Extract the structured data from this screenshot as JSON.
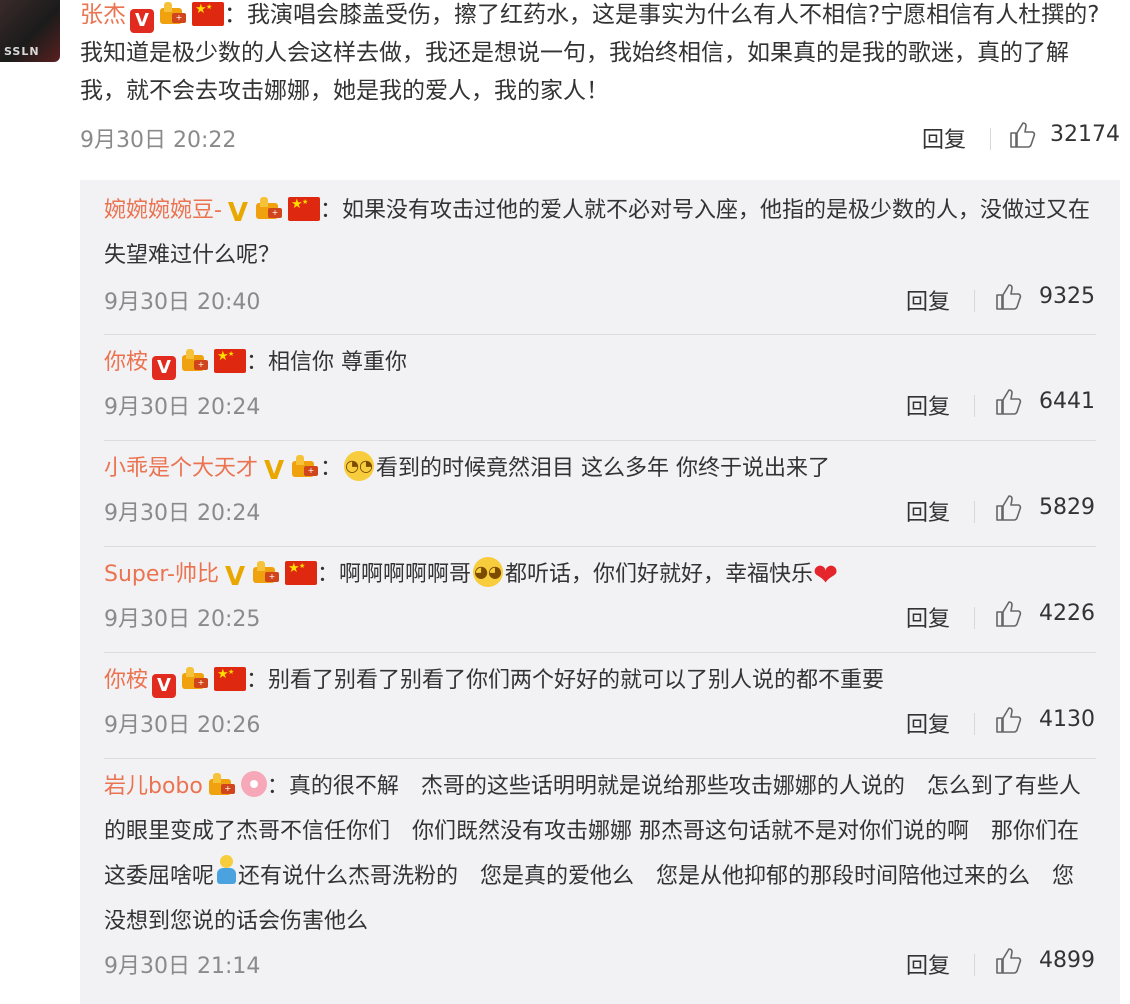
{
  "main_comment": {
    "avatar_text": "SSLN",
    "username": "张杰",
    "separator": "：",
    "text": "我演唱会膝盖受伤，擦了红药水，这是事实为什么有人不相信?宁愿相信有人杜撰的? 我知道是极少数的人会这样去做，我还是想说一句，我始终相信，如果真的是我的歌迷，真的了解我，就不会去攻击娜娜，她是我的爱人，我的家人！",
    "time": "9月30日 20:22",
    "reply_label": "回复",
    "likes": "32174"
  },
  "replies": [
    {
      "username": "婉婉婉婉豆-",
      "separator": "：",
      "text": "如果没有攻击过他的爱人就不必对号入座，他指的是极少数的人，没做过又在失望难过什么呢？",
      "time": "9月30日 20:40",
      "reply_label": "回复",
      "likes": "9325"
    },
    {
      "username": "你桉",
      "separator": "：",
      "text": "相信你 尊重你",
      "time": "9月30日 20:24",
      "reply_label": "回复",
      "likes": "6441"
    },
    {
      "username": "小乖是个大天才",
      "separator": "：",
      "text": "看到的时候竟然泪目 这么多年 你终于说出来了",
      "time": "9月30日 20:24",
      "reply_label": "回复",
      "likes": "5829"
    },
    {
      "username": "Super-帅比",
      "separator": "：",
      "text_a": "啊啊啊啊啊哥",
      "text_b": "都听话，你们好就好，幸福快乐",
      "time": "9月30日 20:25",
      "reply_label": "回复",
      "likes": "4226"
    },
    {
      "username": "你桉",
      "separator": "：",
      "text": "别看了别看了别看了你们两个好好的就可以了别人说的都不重要",
      "time": "9月30日 20:26",
      "reply_label": "回复",
      "likes": "4130"
    },
    {
      "username": "岩儿bobo",
      "separator": "：",
      "text_a": "真的很不解　杰哥的这些话明明就是说给那些攻击娜娜的人说的　怎么到了有些人的眼里变成了杰哥不信任你们　你们既然没有攻击娜娜 那杰哥这句话就不是对你们说的啊　那你们在这委屈啥呢",
      "text_b": "还有说什么杰哥洗粉的　您是真的爱他么　您是从他抑郁的那段时间陪他过来的么　您没想到您说的话会伤害他么",
      "time": "9月30日 21:14",
      "reply_label": "回复",
      "likes": "4899"
    }
  ],
  "badges": {
    "v_mark": "V",
    "lv_mark": "+"
  },
  "colors": {
    "username": "#eb7350",
    "reply_bg": "#f2f2f5",
    "text": "#333333",
    "meta": "#8a8a8a"
  },
  "icons": [
    "thumb-up-icon",
    "verified-v-icon",
    "crown-level-icon",
    "china-flag-icon",
    "donut-icon",
    "emoji-icon",
    "heart-icon"
  ]
}
